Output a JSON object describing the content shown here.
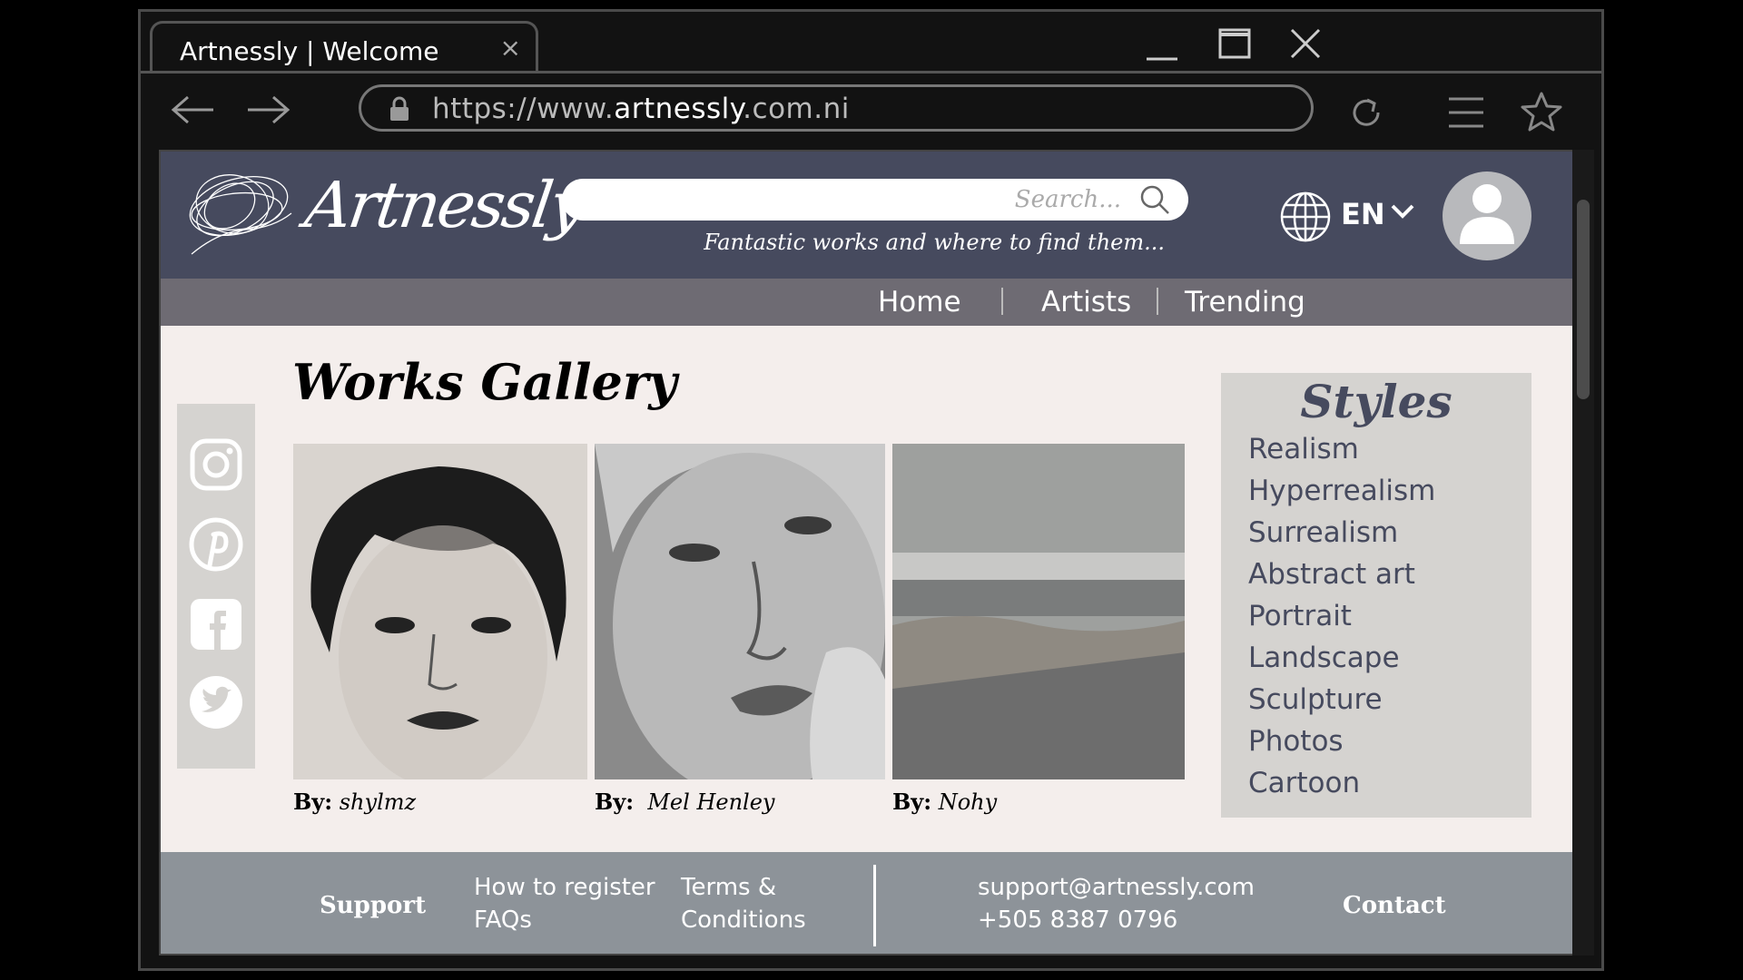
{
  "browser": {
    "tab_title": "Artnessly | Welcome",
    "tab_close": "×",
    "url_prefix": "https://www.",
    "url_domain": "artnessly",
    "url_suffix": ".com.ni"
  },
  "header": {
    "logo_text": "Artnessly",
    "search_placeholder": "Search...",
    "tagline": "Fantastic works and where to find them...",
    "language": "EN"
  },
  "nav": {
    "items": [
      "Home",
      "Artists",
      "Trending"
    ]
  },
  "gallery": {
    "title": "Works Gallery",
    "by_label": "By:",
    "works": [
      {
        "artist": "shylmz"
      },
      {
        "artist": "Mel Henley"
      },
      {
        "artist": "Nohy"
      }
    ]
  },
  "styles": {
    "title": "Styles",
    "items": [
      "Realism",
      "Hyperrealism",
      "Surrealism",
      "Abstract art",
      "Portrait",
      "Landscape",
      "Sculpture",
      "Photos",
      "Cartoon"
    ]
  },
  "footer": {
    "support_label": "Support",
    "register_link": "How to register",
    "faq_link": "FAQs",
    "terms_line1": "Terms &",
    "terms_line2": "Conditions",
    "email": "support@artnessly.com",
    "phone": "+505 8387 0796",
    "contact_label": "Contact"
  },
  "colors": {
    "header_bg": "#464a5e",
    "nav_bg": "#6e6b73",
    "page_bg": "#f4eeec",
    "panel_bg": "#d5d3d0",
    "footer_bg": "#8d9399"
  },
  "icons": [
    "window-minimize-icon",
    "window-maximize-icon",
    "window-close-icon",
    "back-arrow-icon",
    "forward-arrow-icon",
    "lock-icon",
    "reload-icon",
    "menu-icon",
    "bookmark-star-icon",
    "scribble-logo-icon",
    "search-icon",
    "globe-icon",
    "chevron-down-icon",
    "user-avatar-icon",
    "instagram-icon",
    "pinterest-icon",
    "facebook-icon",
    "twitter-icon"
  ]
}
